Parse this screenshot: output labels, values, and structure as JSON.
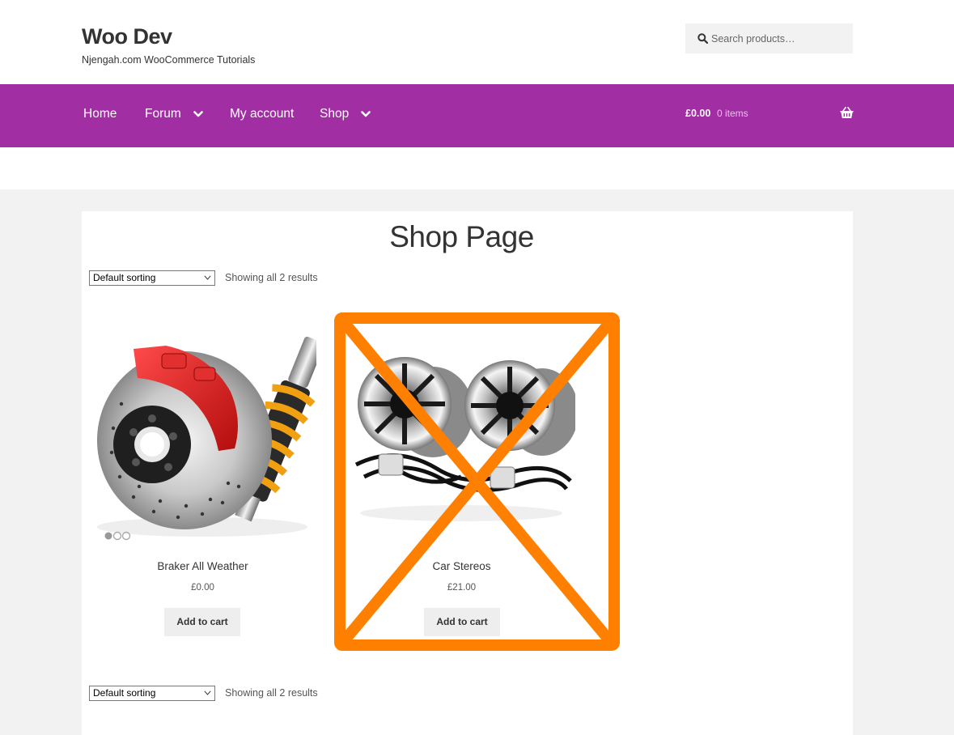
{
  "site": {
    "title": "Woo Dev",
    "description": "Njengah.com WooCommerce Tutorials"
  },
  "search": {
    "placeholder": "Search products…",
    "icon": "search-icon"
  },
  "nav": {
    "items": [
      {
        "label": "Home",
        "has_dropdown": false
      },
      {
        "label": "Forum",
        "has_dropdown": true
      },
      {
        "label": "My account",
        "has_dropdown": false
      },
      {
        "label": "Shop",
        "has_dropdown": true
      }
    ],
    "cart_amount": "£0.00",
    "cart_items": "0 items",
    "cart_icon": "basket-icon"
  },
  "page": {
    "title": "Shop Page"
  },
  "toolbar_top": {
    "sorting": "Default sorting",
    "result_count": "Showing all 2 results"
  },
  "toolbar_bottom": {
    "sorting": "Default sorting",
    "result_count": "Showing all 2 results"
  },
  "products": [
    {
      "name": "Braker All Weather",
      "price": "£0.00",
      "button": "Add to cart",
      "image": "brake-disc-and-shock-absorber-photo"
    },
    {
      "name": "Car Stereos",
      "price": "£21.00",
      "button": "Add to cart",
      "image": "car-speakers-photo",
      "crossed_out": true
    }
  ],
  "colors": {
    "nav_bg": "#a22ea3",
    "cross_overlay": "#ff8000",
    "content_bg": "#f2f2f2"
  }
}
